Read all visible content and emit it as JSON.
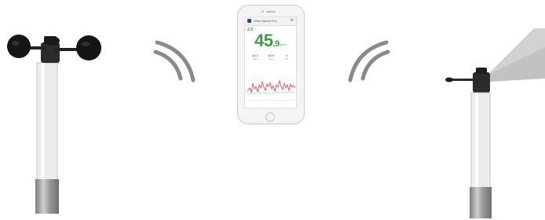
{
  "phone_app": {
    "header_title": "Wind Speed Pro",
    "mini_reading": "2.9",
    "big_reading_int": "45",
    "big_reading_dec": ".9",
    "unit": "km/h",
    "stats": [
      {
        "value": "44.2",
        "label": "Min"
      },
      {
        "value": "45.9",
        "label": "Avg"
      },
      {
        "value": "4",
        "label": "Dir"
      }
    ]
  },
  "colors": {
    "reading_green": "#3aa04a",
    "chart_red": "#d9534f",
    "signal_gray": "#8a8a8a"
  }
}
